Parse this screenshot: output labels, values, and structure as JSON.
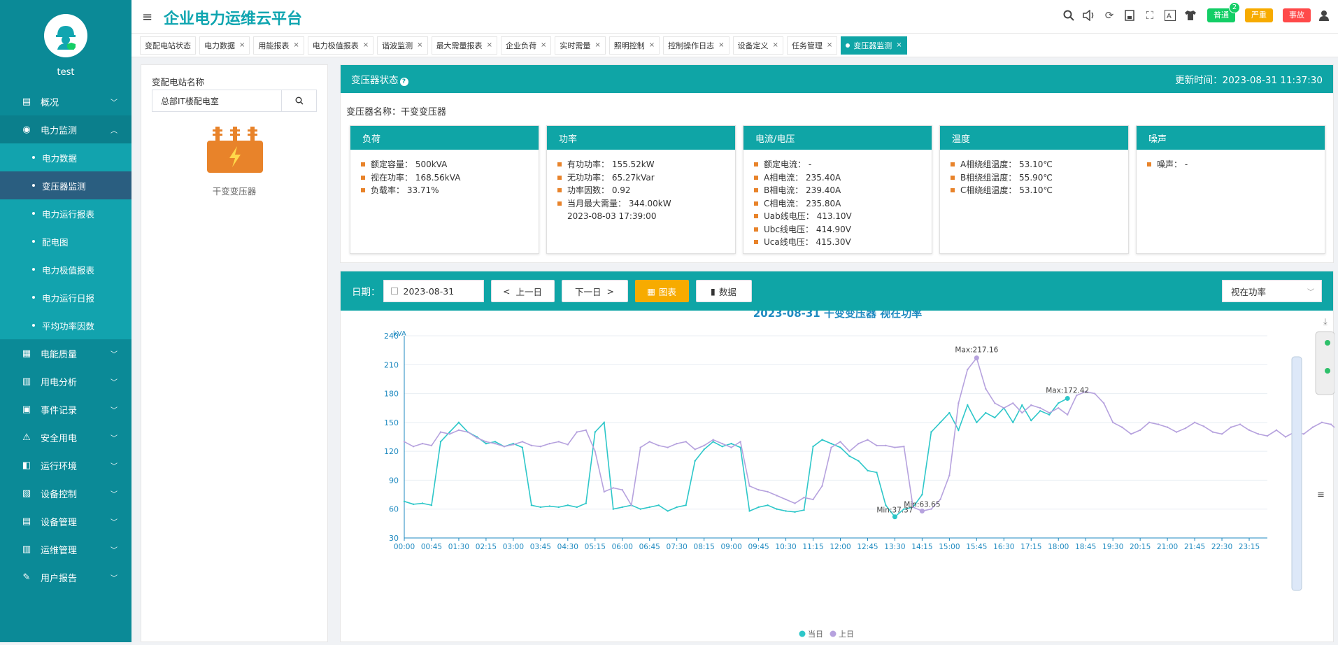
{
  "sidebar": {
    "username": "test",
    "menu": [
      {
        "label": "概况",
        "icon": "monitor-icon"
      },
      {
        "label": "电力监测",
        "icon": "compass-icon",
        "open": true,
        "children": [
          {
            "label": "电力数据"
          },
          {
            "label": "变压器监测",
            "active": true
          },
          {
            "label": "电力运行报表"
          },
          {
            "label": "配电图"
          },
          {
            "label": "电力极值报表"
          },
          {
            "label": "电力运行日报"
          },
          {
            "label": "平均功率因数"
          }
        ]
      },
      {
        "label": "电能质量",
        "icon": "quality-chart-icon"
      },
      {
        "label": "用电分析",
        "icon": "bar-chart-icon"
      },
      {
        "label": "事件记录",
        "icon": "event-log-icon"
      },
      {
        "label": "安全用电",
        "icon": "alarm-icon"
      },
      {
        "label": "运行环境",
        "icon": "camera-icon"
      },
      {
        "label": "设备控制",
        "icon": "device-control-icon"
      },
      {
        "label": "设备管理",
        "icon": "device-manage-icon"
      },
      {
        "label": "运维管理",
        "icon": "maintenance-icon"
      },
      {
        "label": "用户报告",
        "icon": "edit-report-icon"
      }
    ]
  },
  "header": {
    "title": "企业电力运维云平台",
    "badges": [
      {
        "label": "普通",
        "color": "#13ce66",
        "count": "2"
      },
      {
        "label": "严重",
        "color": "#f7ab00"
      },
      {
        "label": "事故",
        "color": "#ff4949"
      }
    ]
  },
  "tabs": [
    {
      "label": "变配电站状态",
      "closable": false
    },
    {
      "label": "电力数据",
      "closable": true
    },
    {
      "label": "用能报表",
      "closable": true
    },
    {
      "label": "电力极值报表",
      "closable": true
    },
    {
      "label": "谐波监测",
      "closable": true
    },
    {
      "label": "最大需量报表",
      "closable": true
    },
    {
      "label": "企业负荷",
      "closable": true
    },
    {
      "label": "实时需量",
      "closable": true
    },
    {
      "label": "照明控制",
      "closable": true
    },
    {
      "label": "控制操作日志",
      "closable": true
    },
    {
      "label": "设备定义",
      "closable": true
    },
    {
      "label": "任务管理",
      "closable": true
    },
    {
      "label": "变压器监测",
      "closable": true,
      "active": true
    }
  ],
  "left_panel": {
    "label": "变配电站名称",
    "station_value": "总部IT楼配电室",
    "transformer_name": "干变变压器"
  },
  "status": {
    "title": "变压器状态",
    "update_time": "更新时间：2023-08-31 11:37:30",
    "transformer_label": "变压器名称：干变变压器",
    "cards": [
      {
        "title": "负荷",
        "items": [
          "额定容量：  500kVA",
          "视在功率：  168.56kVA",
          "负载率：  33.71%"
        ]
      },
      {
        "title": "功率",
        "items": [
          "有功功率：  155.52kW",
          "无功功率：  65.27kVar",
          "功率因数：  0.92",
          "当月最大需量：  344.00kW"
        ],
        "sub": "2023-08-03 17:39:00"
      },
      {
        "title": "电流/电压",
        "items": [
          "额定电流：  -",
          "A相电流：  235.40A",
          "B相电流：  239.40A",
          "C相电流：  235.80A",
          "Uab线电压：  413.10V",
          "Ubc线电压：  414.90V",
          "Uca线电压：  415.30V"
        ]
      },
      {
        "title": "温度",
        "items": [
          "A相绕组温度：  53.10℃",
          "B相绕组温度：  55.90℃",
          "C相绕组温度：  53.10℃"
        ]
      },
      {
        "title": "噪声",
        "items": [
          "噪声：  -"
        ]
      }
    ]
  },
  "toolbar": {
    "date_label": "日期：",
    "date_value": "2023-08-31",
    "prev_label": "上一日",
    "next_label": "下一日",
    "chart_label": "图表",
    "data_label": "数据",
    "metric_select": "视在功率"
  },
  "chart_data": {
    "type": "line",
    "title": "2023-08-31    干变变压器    视在功率",
    "ylabel": "kVA",
    "ylim": [
      30,
      240
    ],
    "yticks": [
      30,
      60,
      90,
      120,
      150,
      180,
      210,
      240
    ],
    "x_ticks": [
      "00:00",
      "00:45",
      "01:30",
      "02:15",
      "03:00",
      "03:45",
      "04:30",
      "05:15",
      "06:00",
      "06:45",
      "07:30",
      "08:15",
      "09:00",
      "09:45",
      "10:30",
      "11:15",
      "12:00",
      "12:45",
      "13:30",
      "14:15",
      "15:00",
      "15:45",
      "16:30",
      "17:15",
      "18:00",
      "18:45",
      "19:30",
      "20:15",
      "21:00",
      "21:45",
      "22:30",
      "23:15"
    ],
    "x_step_minutes": 15,
    "legend_position": "bottom-center",
    "series": [
      {
        "name": "当日",
        "color": "#2ec7c9",
        "values": [
          68,
          65,
          66,
          64,
          130,
          140,
          150,
          140,
          135,
          128,
          130,
          125,
          128,
          124,
          64,
          62,
          63,
          62,
          64,
          62,
          66,
          140,
          150,
          60,
          62,
          64,
          60,
          62,
          64,
          58,
          62,
          64,
          110,
          122,
          130,
          125,
          128,
          124,
          58,
          62,
          64,
          60,
          58,
          57,
          59,
          125,
          132,
          128,
          124,
          115,
          110,
          100,
          98,
          64,
          52,
          60,
          62,
          75,
          140,
          150,
          160,
          142,
          168,
          150,
          160,
          155,
          165,
          150,
          168,
          152,
          162,
          158,
          170,
          175
        ]
      },
      {
        "name": "上日",
        "color": "#b6a2de",
        "values": [
          130,
          125,
          128,
          126,
          140,
          138,
          142,
          140,
          134,
          130,
          128,
          125,
          127,
          130,
          126,
          125,
          128,
          130,
          127,
          140,
          142,
          120,
          78,
          82,
          80,
          64,
          124,
          130,
          126,
          124,
          128,
          130,
          122,
          126,
          132,
          128,
          124,
          130,
          84,
          80,
          78,
          74,
          70,
          66,
          72,
          70,
          84,
          124,
          130,
          120,
          128,
          132,
          126,
          126,
          124,
          125,
          62,
          58,
          60,
          70,
          95,
          170,
          205,
          217,
          185,
          170,
          165,
          170,
          160,
          168,
          165,
          160,
          165,
          158,
          178,
          182,
          180,
          170,
          150,
          145,
          138,
          142,
          150,
          148,
          145,
          140,
          144,
          150,
          146,
          140,
          138,
          145,
          148,
          142,
          138,
          136,
          142,
          135,
          140,
          138,
          145,
          150,
          148,
          140,
          135,
          138,
          142,
          150,
          156,
          150,
          148,
          152,
          146,
          140,
          145,
          150,
          152,
          148,
          146,
          145,
          150,
          140,
          138,
          140,
          142,
          145,
          80,
          78,
          80,
          76,
          140,
          145,
          142,
          138,
          140,
          144,
          146,
          82,
          80,
          78,
          140,
          150,
          155,
          148,
          146,
          144,
          140,
          75,
          65,
          74
        ]
      }
    ],
    "markers": [
      {
        "label": "Max:217.16",
        "series": "上日"
      },
      {
        "label": "Max:172.42",
        "series": "当日"
      },
      {
        "label": "Min:63.65",
        "series": "上日"
      },
      {
        "label": "Min:37.37",
        "series": "当日"
      }
    ]
  }
}
